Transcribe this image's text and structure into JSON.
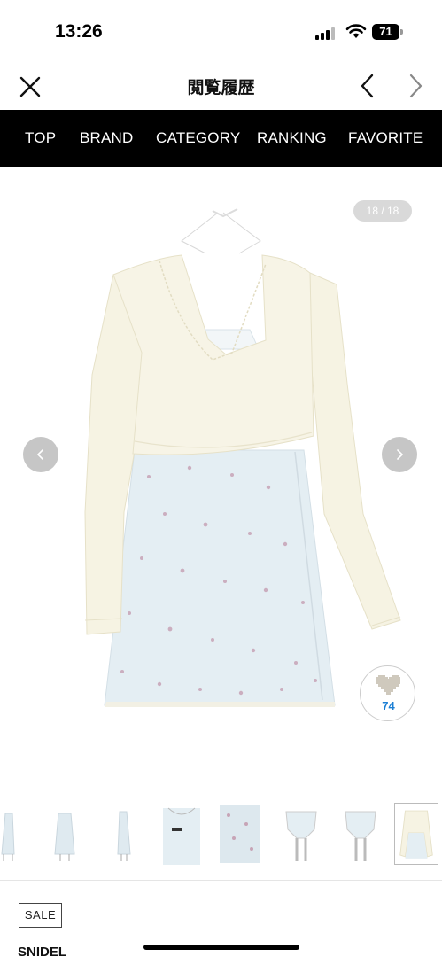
{
  "status_bar": {
    "time": "13:26",
    "battery": "71"
  },
  "header": {
    "title": "閲覧履歴"
  },
  "nav": {
    "items": [
      "TOP",
      "BRAND",
      "CATEGORY",
      "RANKING",
      "FAVORITE"
    ]
  },
  "gallery": {
    "counter": "18 / 18",
    "likes": "74"
  },
  "product": {
    "badge": "SALE",
    "brand": "SNIDEL"
  },
  "icons": {
    "close": "close-icon",
    "prev": "chevron-left-icon",
    "next": "chevron-right-icon",
    "like": "heart-icon"
  },
  "colors": {
    "nav_bg": "#000000",
    "like_count": "#1c7fd4",
    "counter_bg": "#d9d9d9"
  }
}
